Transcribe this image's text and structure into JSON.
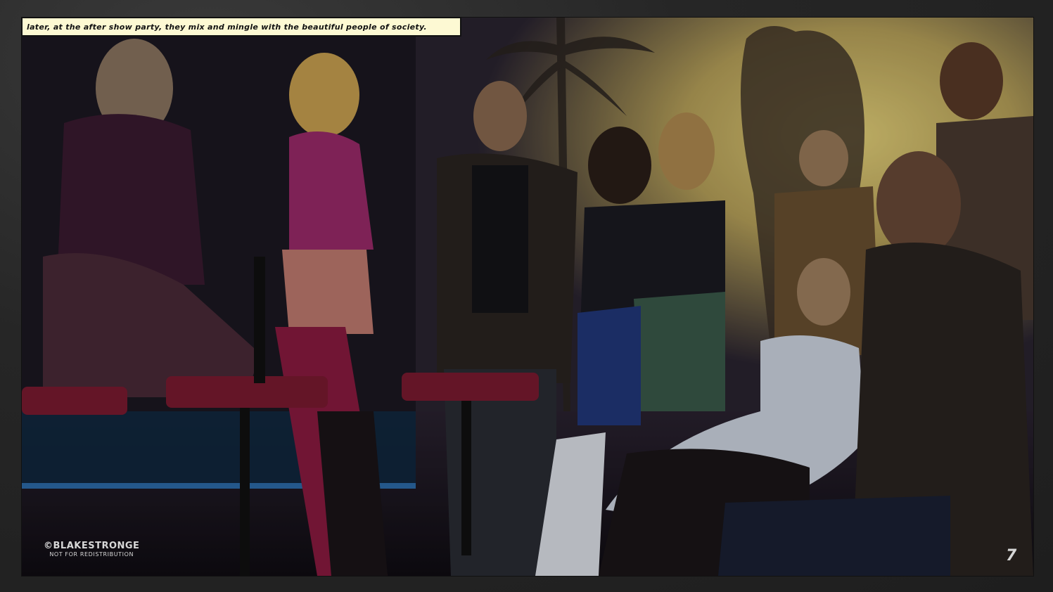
{
  "caption": "Later, at the after show party, they mix and mingle with the beautiful people of society.",
  "credit": {
    "main": "©BLAKESTRONGE",
    "sub": "NOT FOR REDISTRIBUTION"
  },
  "page_number": "7",
  "colors": {
    "caption_bg": "#fdf9d3",
    "sky_glow": "#d8c26a",
    "page_border": "#2a2a2a"
  }
}
